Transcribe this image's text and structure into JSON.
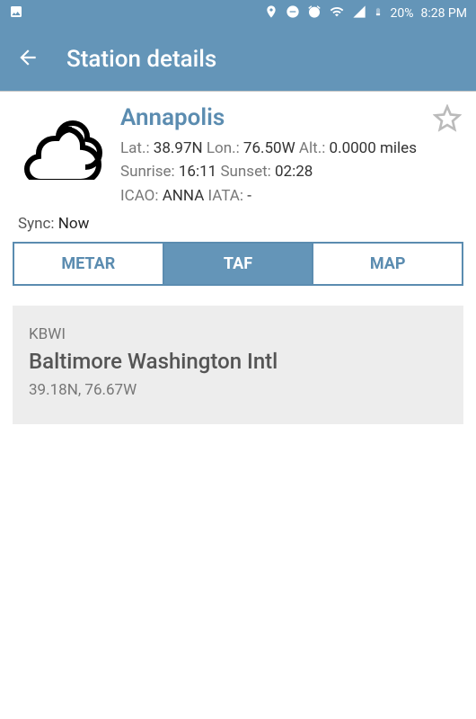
{
  "status": {
    "battery": "20%",
    "time": "8:28 PM"
  },
  "appbar": {
    "title": "Station details"
  },
  "station": {
    "name": "Annapolis",
    "lat_label": "Lat.:",
    "lat": "38.97N",
    "lon_label": "Lon.:",
    "lon": "76.50W",
    "alt_label": "Alt.:",
    "alt": "0.0000 miles",
    "sunrise_label": "Sunrise:",
    "sunrise": "16:11",
    "sunset_label": "Sunset:",
    "sunset": "02:28",
    "icao_label": "ICAO:",
    "icao": "ANNA",
    "iata_label": "IATA:",
    "iata": "-",
    "sync_label": "Sync:",
    "sync": "Now"
  },
  "tabs": {
    "metar": "METAR",
    "taf": "TAF",
    "map": "MAP",
    "active": "taf"
  },
  "card": {
    "icao": "KBWI",
    "name": "Baltimore Washington Intl",
    "coords": "39.18N, 76.67W"
  }
}
